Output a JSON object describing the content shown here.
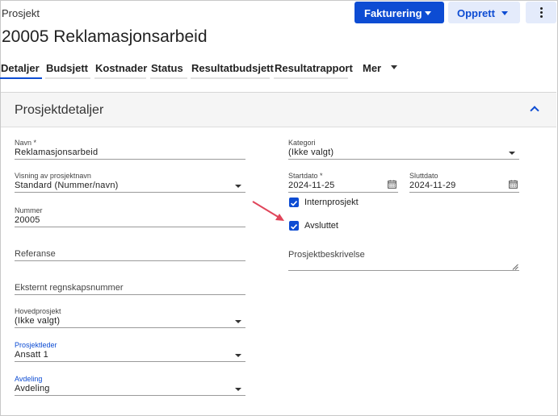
{
  "header": {
    "breadcrumb": "Prosjekt",
    "title": "20005 Reklamasjonsarbeid",
    "buttons": {
      "invoicing": "Fakturering",
      "create": "Opprett"
    }
  },
  "tabs": [
    "Detaljer",
    "Budsjett",
    "Kostnader",
    "Status",
    "Resultatbudsjett",
    "Resultatrapport",
    "Mer"
  ],
  "panel": {
    "title": "Prosjektdetaljer"
  },
  "form": {
    "name": {
      "label": "Navn *",
      "value": "Reklamasjonsarbeid"
    },
    "display": {
      "label": "Visning av prosjektnavn",
      "value": "Standard (Nummer/navn)"
    },
    "number": {
      "label": "Nummer",
      "value": "20005"
    },
    "reference": {
      "placeholder": "Referanse"
    },
    "external_number": {
      "placeholder": "Eksternt regnskapsnummer"
    },
    "main_project": {
      "label": "Hovedprosjekt",
      "value": "(Ikke valgt)"
    },
    "project_manager": {
      "label": "Prosjektleder",
      "value": "Ansatt 1"
    },
    "department": {
      "label": "Avdeling",
      "value": "Avdeling"
    },
    "category": {
      "label": "Kategori",
      "value": "(Ikke valgt)"
    },
    "start_date": {
      "label": "Startdato *",
      "value": "2024-11-25"
    },
    "end_date": {
      "label": "Sluttdato",
      "value": "2024-11-29"
    },
    "internal_project": {
      "label": "Internprosjekt",
      "checked": true
    },
    "closed": {
      "label": "Avsluttet",
      "checked": true
    },
    "description": {
      "placeholder": "Prosjektbeskrivelse"
    }
  },
  "colors": {
    "accent": "#0d4cd3",
    "accent_light": "#e4ebfb",
    "annotation_arrow": "#e0455a"
  }
}
